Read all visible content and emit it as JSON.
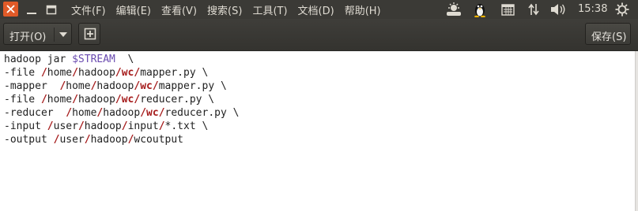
{
  "window": {
    "close_icon": "close-icon",
    "minimize_icon": "minimize-icon",
    "maximize_icon": "maximize-icon"
  },
  "menubar": {
    "items": [
      "文件(F)",
      "编辑(E)",
      "查看(V)",
      "搜索(S)",
      "工具(T)",
      "文档(D)",
      "帮助(H)"
    ]
  },
  "tray": {
    "icons": [
      "weather-icon",
      "tux-icon",
      "calendar-icon",
      "network-icon",
      "volume-icon",
      "power-icon"
    ],
    "clock": "15:38"
  },
  "toolbar": {
    "open_label": "打开(O)",
    "open_dropdown_icon": "chevron-down-icon",
    "new_tab_icon": "new-document-icon",
    "save_label": "保存(S)"
  },
  "editor": {
    "lines": [
      "hadoop jar $STREAM  \\",
      "-file /home/hadoop/wc/mapper.py \\",
      "-mapper  /home/hadoop/wc/mapper.py \\",
      "-file /home/hadoop/wc/reducer.py \\",
      "-reducer  /home/hadoop/wc/reducer.py \\",
      "-input /user/hadoop/input/*.txt \\",
      "-output /user/hadoop/wcoutput"
    ],
    "highlight_color": "#a61d1d",
    "variable_color": "#6a4bb0"
  },
  "colors": {
    "menubar_bg": "#3b3a36",
    "close_button": "#e05a28",
    "editor_bg": "#ffffff"
  }
}
